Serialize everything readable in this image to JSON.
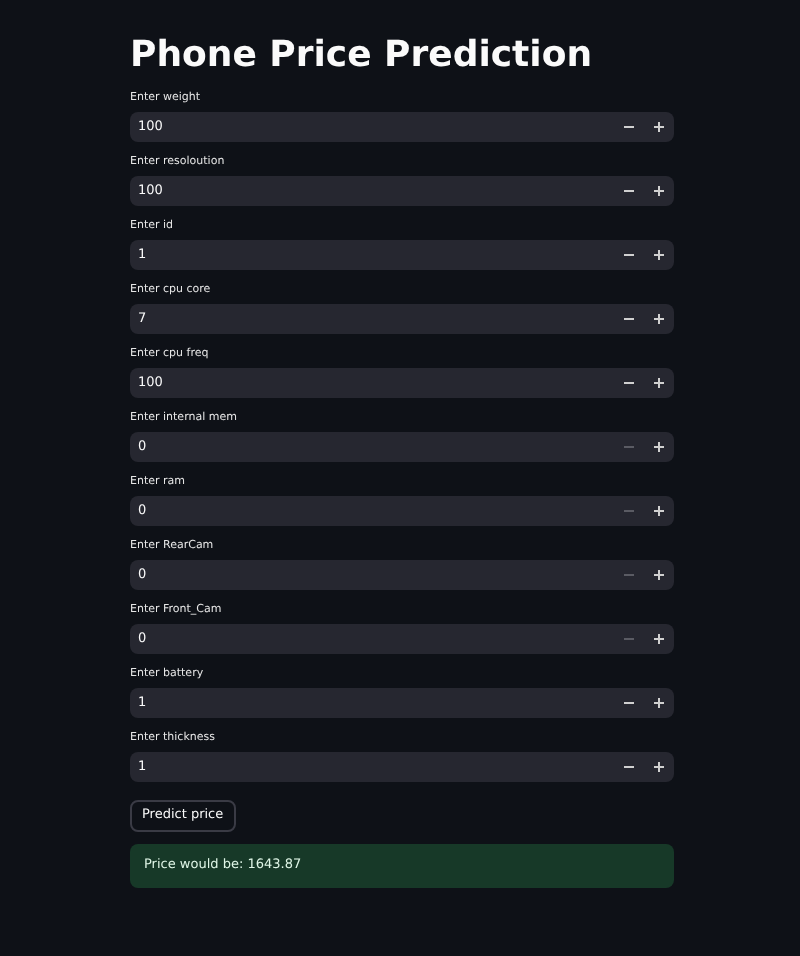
{
  "title": "Phone Price Prediction",
  "fields": [
    {
      "label": "Enter weight",
      "value": "100",
      "minus_disabled": false
    },
    {
      "label": "Enter resoloution",
      "value": "100",
      "minus_disabled": false
    },
    {
      "label": "Enter id",
      "value": "1",
      "minus_disabled": false
    },
    {
      "label": "Enter cpu core",
      "value": "7",
      "minus_disabled": false
    },
    {
      "label": "Enter cpu freq",
      "value": "100",
      "minus_disabled": false
    },
    {
      "label": "Enter internal mem",
      "value": "0",
      "minus_disabled": true
    },
    {
      "label": "Enter ram",
      "value": "0",
      "minus_disabled": true
    },
    {
      "label": "Enter RearCam",
      "value": "0",
      "minus_disabled": true
    },
    {
      "label": "Enter Front_Cam",
      "value": "0",
      "minus_disabled": true
    },
    {
      "label": "Enter battery",
      "value": "1",
      "minus_disabled": false
    },
    {
      "label": "Enter thickness",
      "value": "1",
      "minus_disabled": false
    }
  ],
  "button": "Predict price",
  "result": "Price would be: 1643.87"
}
